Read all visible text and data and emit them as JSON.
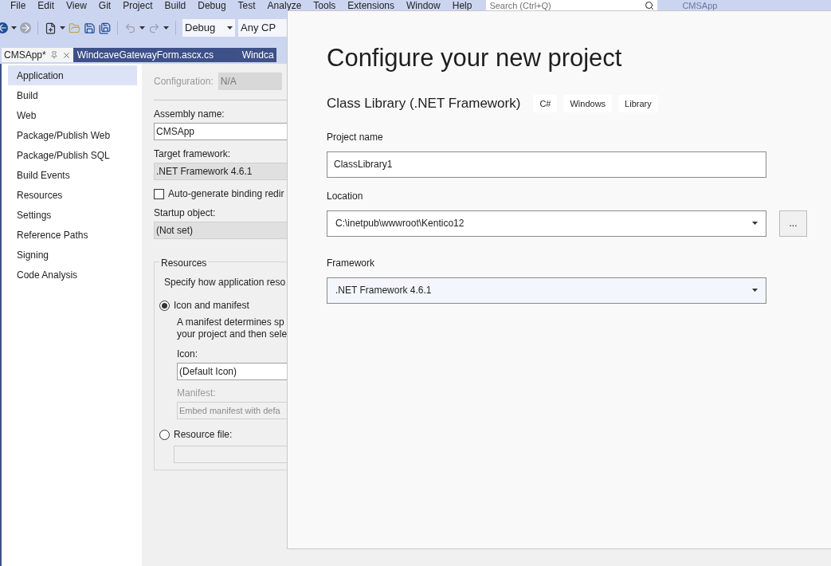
{
  "menu": [
    "File",
    "Edit",
    "View",
    "Git",
    "Project",
    "Build",
    "Debug",
    "Test",
    "Analyze",
    "Tools",
    "Extensions",
    "Window",
    "Help"
  ],
  "search": {
    "placeholder": "Search (Ctrl+Q)"
  },
  "solution_name": "CMSApp",
  "toolbar": {
    "configuration": "Debug",
    "platform": "Any CP"
  },
  "tabs": [
    {
      "label": "CMSApp*",
      "selected": true
    },
    {
      "label": "WindcaveGatewayForm.ascx.cs",
      "selected": false
    },
    {
      "label": "Windca",
      "selected": false
    }
  ],
  "sidebar": [
    {
      "label": "Application",
      "selected": true
    },
    {
      "label": "Build",
      "selected": false
    },
    {
      "label": "Web",
      "selected": false
    },
    {
      "label": "Package/Publish Web",
      "selected": false
    },
    {
      "label": "Package/Publish SQL",
      "selected": false
    },
    {
      "label": "Build Events",
      "selected": false
    },
    {
      "label": "Resources",
      "selected": false
    },
    {
      "label": "Settings",
      "selected": false
    },
    {
      "label": "Reference Paths",
      "selected": false
    },
    {
      "label": "Signing",
      "selected": false
    },
    {
      "label": "Code Analysis",
      "selected": false
    }
  ],
  "properties": {
    "configuration_label": "Configuration:",
    "configuration_value": "N/A",
    "assembly_label": "Assembly name:",
    "assembly_value": "CMSApp",
    "framework_label": "Target framework:",
    "framework_value": ".NET Framework 4.6.1",
    "binding": {
      "label": "Auto-generate binding redir",
      "checked": false
    },
    "startup_label": "Startup object:",
    "startup_value": "(Not set)",
    "resources": {
      "title": "Resources",
      "hint": "Specify how application reso",
      "options": [
        {
          "label": "Icon and manifest",
          "selected": true
        },
        {
          "label": "Resource file:",
          "selected": false
        }
      ],
      "description": [
        "A manifest determines sp",
        "your project and then sele"
      ],
      "icon_label": "Icon:",
      "icon_value": "(Default Icon)",
      "manifest_label": "Manifest:",
      "manifest_value": "Embed manifest with defa"
    }
  },
  "dialog": {
    "title": "Configure your new project",
    "template": "Class Library (.NET Framework)",
    "tags": [
      "C#",
      "Windows",
      "Library"
    ],
    "project_name_label": "Project name",
    "project_name": "ClassLibrary1",
    "location_label": "Location",
    "location": "C:\\inetpub\\wwwroot\\Kentico12",
    "browse": "...",
    "framework_label": "Framework",
    "framework": ".NET Framework 4.6.1"
  }
}
